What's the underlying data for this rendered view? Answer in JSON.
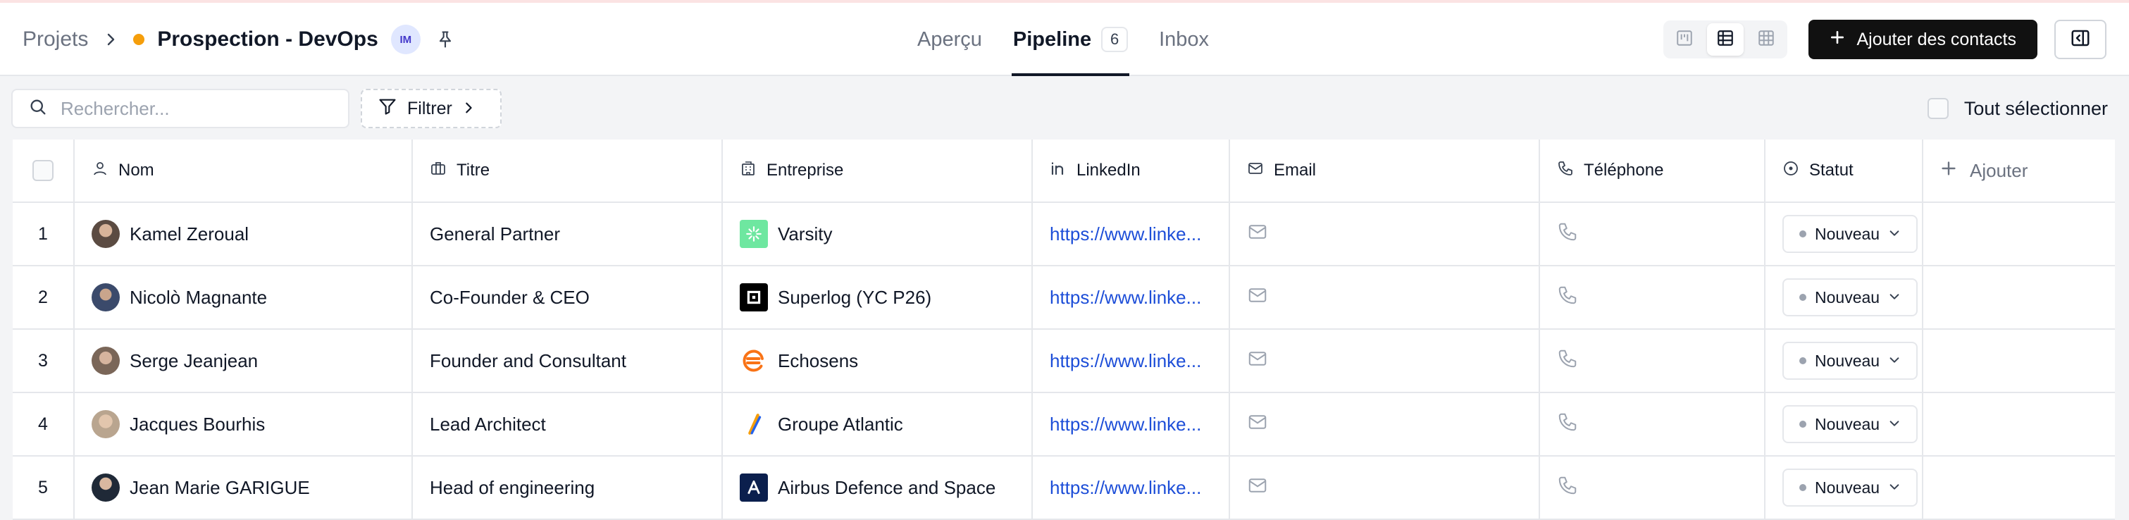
{
  "header": {
    "breadcrumb_root": "Projets",
    "project_title": "Prospection - DevOps",
    "avatar_initials": "IM",
    "tabs": [
      {
        "label": "Aperçu",
        "active": false
      },
      {
        "label": "Pipeline",
        "active": true,
        "count": "6"
      },
      {
        "label": "Inbox",
        "active": false
      }
    ],
    "add_contacts_label": "Ajouter des contacts"
  },
  "toolbar": {
    "search_placeholder": "Rechercher...",
    "filter_label": "Filtrer",
    "select_all_label": "Tout sélectionner"
  },
  "table": {
    "columns": [
      "Nom",
      "Titre",
      "Entreprise",
      "LinkedIn",
      "Email",
      "Téléphone",
      "Statut"
    ],
    "add_column_label": "Ajouter",
    "rows": [
      {
        "num": "1",
        "name": "Kamel Zeroual",
        "title": "General Partner",
        "company": "Varsity",
        "linkedin": "https://www.linke...",
        "status": "Nouveau"
      },
      {
        "num": "2",
        "name": "Nicolò Magnante",
        "title": "Co-Founder & CEO",
        "company": "Superlog (YC P26)",
        "linkedin": "https://www.linke...",
        "status": "Nouveau"
      },
      {
        "num": "3",
        "name": "Serge Jeanjean",
        "title": "Founder and Consultant",
        "company": "Echosens",
        "linkedin": "https://www.linke...",
        "status": "Nouveau"
      },
      {
        "num": "4",
        "name": "Jacques Bourhis",
        "title": "Lead Architect",
        "company": "Groupe Atlantic",
        "linkedin": "https://www.linke...",
        "status": "Nouveau"
      },
      {
        "num": "5",
        "name": "Jean Marie GARIGUE",
        "title": "Head of engineering",
        "company": "Airbus Defence and Space",
        "linkedin": "https://www.linke...",
        "status": "Nouveau"
      }
    ]
  },
  "colors": {
    "accent_dark": "#111111",
    "project_dot": "#f59e0b",
    "link": "#1d4ed8"
  }
}
